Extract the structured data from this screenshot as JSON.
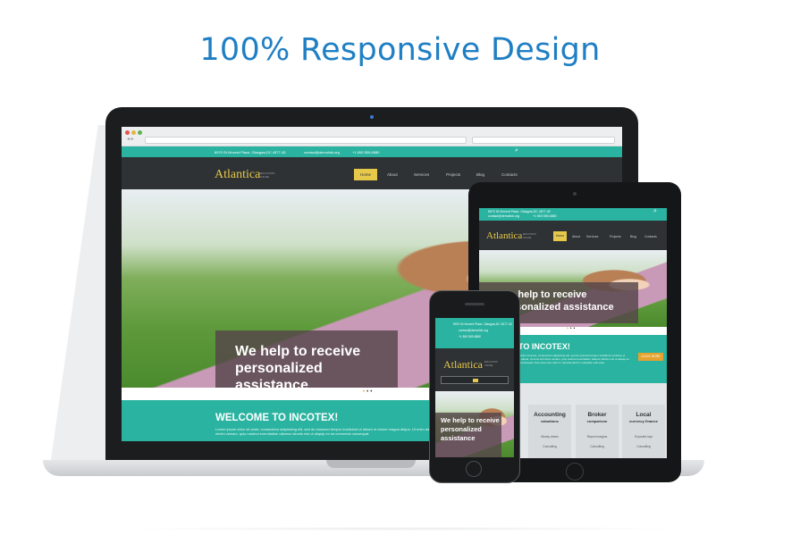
{
  "headline": "100% Responsive Design",
  "site": {
    "logo": "Atlantica",
    "logo_tagline": "EDUCATION ONLINE",
    "address": "8970 St.Vincent Place, Glasgow,DC 4577-45",
    "email": "contact@demolink.org",
    "phone": "+1 800 559-6580",
    "menu": [
      "Home",
      "About",
      "Services",
      "Projects",
      "Blog",
      "Contacts"
    ],
    "hero_text": "We help to receive personalized assistance",
    "welcome_title": "WELCOME TO INCOTEX!",
    "welcome_body": "Lorem ipsum dolor sit amet, consectetur adipisicing elit, sed do eiusmod tempor incididunt ut labore et dolore magna aliqua. Ut enim ad minim veniam, quis nostrud exercitation ullamco laboris nisi ut aliquip ex ea commodo consequat.",
    "tablet_welcome": "ME TO INCOTEX!",
    "tablet_welcome_body": "Lorem ipsum dolor sit amet, consectetur adipisicing elit, sed do eiusmod tempor incididunt ut labore et dolore magna aliqua. Ut enim ad minim veniam, quis nostrud exercitation ullamco laboris nisi ut aliquip ex ea commodo consequat. Duis aute irure dolor in reprehenderit in voluptate velit esse.",
    "cta_label": "CLICK HERE",
    "services": [
      {
        "title": "Accounting",
        "sub": "valuations",
        "lines": [
          "Money drives",
          "Consulting"
        ]
      },
      {
        "title": "Broker",
        "sub": "comparison",
        "lines": [
          "Report margins",
          "Consulting"
        ]
      },
      {
        "title": "Local",
        "sub": "currency finance",
        "lines": [
          "Exported rapt",
          "Consulting"
        ]
      }
    ]
  },
  "colors": {
    "brand_blue": "#1f7fc4",
    "teal": "#2ab3a0",
    "dark_header": "#2e3234",
    "gold": "#e6c84a"
  }
}
